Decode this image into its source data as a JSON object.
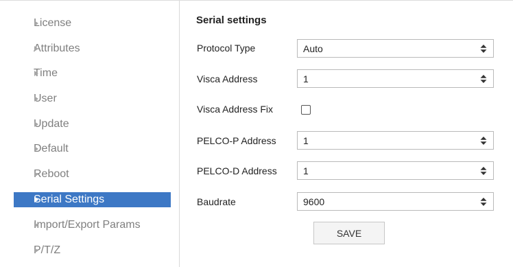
{
  "sidebar": {
    "items": [
      {
        "label": "License"
      },
      {
        "label": "Attributes"
      },
      {
        "label": "Time"
      },
      {
        "label": "User"
      },
      {
        "label": "Update"
      },
      {
        "label": "Default"
      },
      {
        "label": "Reboot"
      },
      {
        "label": "Serial Settings",
        "active": true
      },
      {
        "label": "Import/Export Params"
      },
      {
        "label": "P/T/Z"
      }
    ],
    "active_color": "#3d78c5"
  },
  "serial": {
    "title": "Serial settings",
    "protocol_type": {
      "label": "Protocol Type",
      "value": "Auto"
    },
    "visca_address": {
      "label": "Visca Address",
      "value": "1"
    },
    "visca_address_fix": {
      "label": "Visca Address Fix",
      "checked": false
    },
    "pelco_p_address": {
      "label": "PELCO-P Address",
      "value": "1"
    },
    "pelco_d_address": {
      "label": "PELCO-D Address",
      "value": "1"
    },
    "baudrate": {
      "label": "Baudrate",
      "value": "9600"
    },
    "save_label": "SAVE"
  },
  "icons": {
    "sidebar_bullet": "triangle-right-icon",
    "select_arrows": "up-down-arrows-icon"
  }
}
